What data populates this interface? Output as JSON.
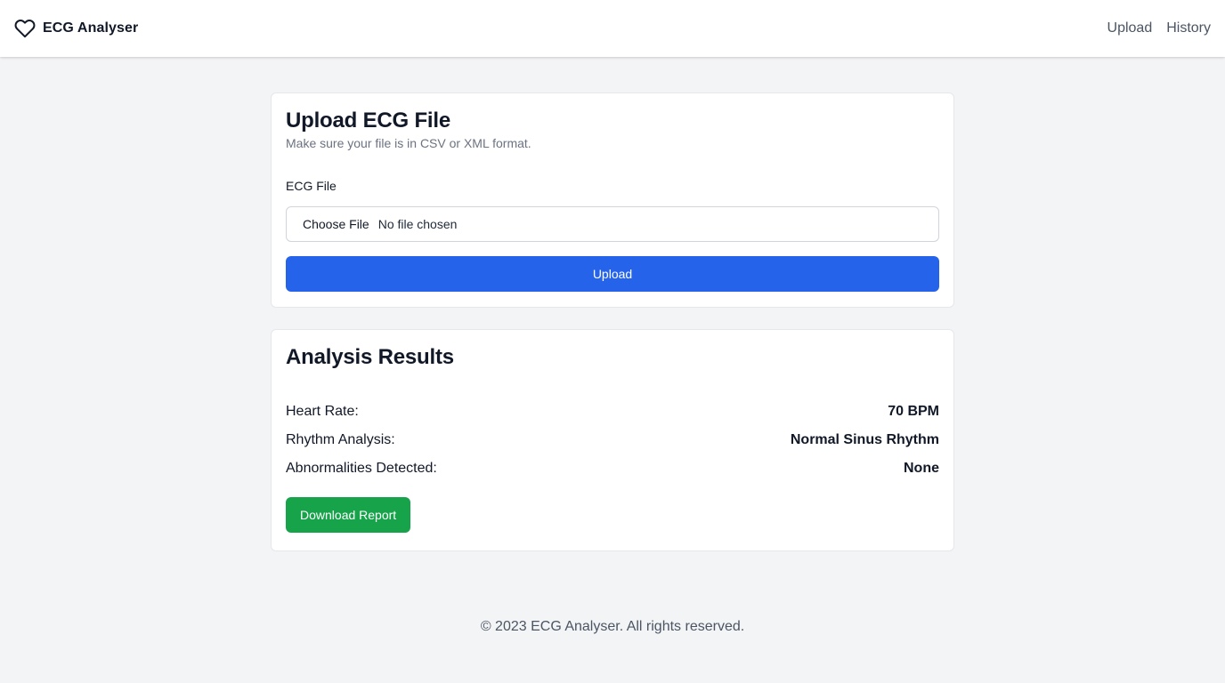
{
  "app": {
    "name": "ECG Analyser",
    "logo_icon": "heart-icon"
  },
  "nav": {
    "links": [
      {
        "label": "Upload"
      },
      {
        "label": "History"
      }
    ]
  },
  "upload_card": {
    "title": "Upload ECG File",
    "subtitle": "Make sure your file is in CSV or XML format.",
    "field_label": "ECG File",
    "file_button_label": "Choose File",
    "file_status": "No file chosen",
    "submit_label": "Upload"
  },
  "results_card": {
    "title": "Analysis Results",
    "rows": [
      {
        "label": "Heart Rate:",
        "value": "70 BPM"
      },
      {
        "label": "Rhythm Analysis:",
        "value": "Normal Sinus Rhythm"
      },
      {
        "label": "Abnormalities Detected:",
        "value": "None"
      }
    ],
    "download_label": "Download Report"
  },
  "footer": {
    "text": "© 2023 ECG Analyser. All rights reserved."
  },
  "colors": {
    "primary": "#2563eb",
    "success": "#16a34a",
    "background": "#f3f4f6"
  }
}
